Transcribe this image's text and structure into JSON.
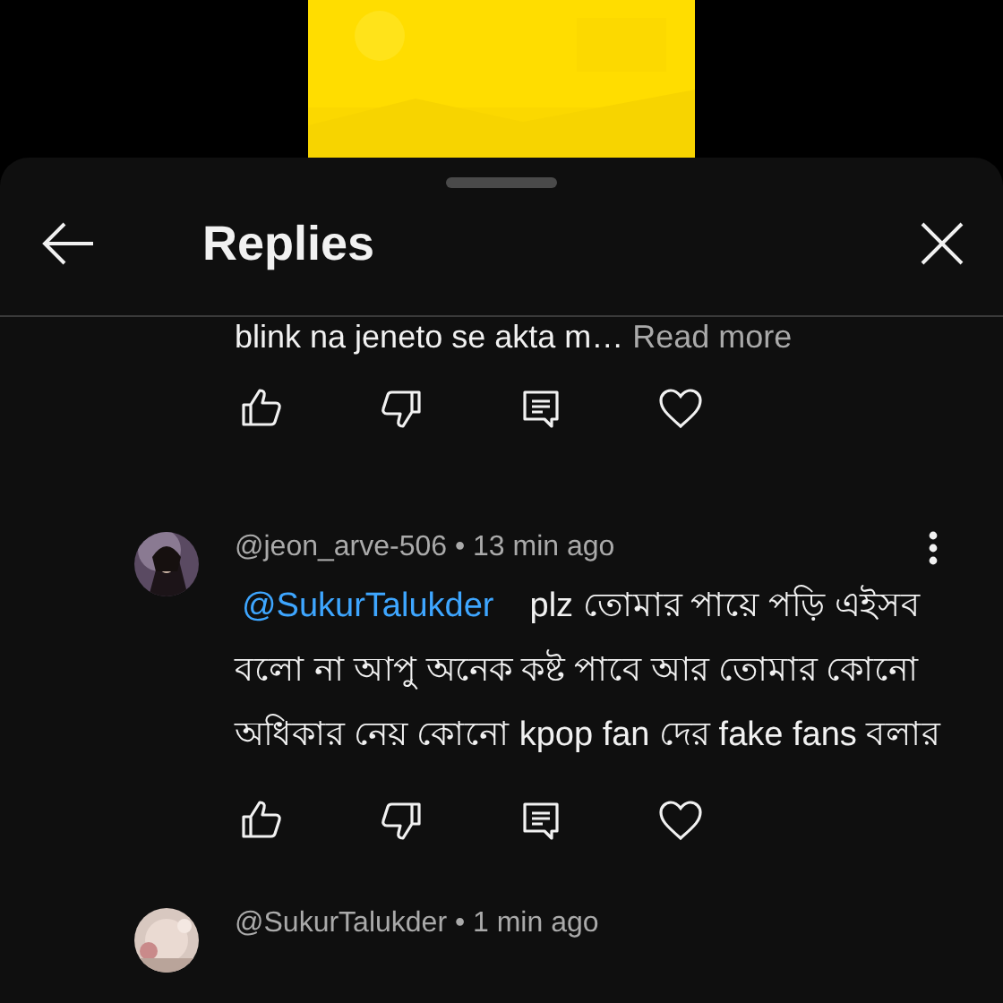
{
  "title": "Replies",
  "comments": [
    {
      "kind": "tail",
      "text": "blink na jeneto se akta m…",
      "read_more": "Read more"
    },
    {
      "kind": "full",
      "meta": "@jeon_arve-506 • 13 min ago",
      "mention": "@SukurTalukder",
      "text": "plz তোমার পায়ে পড়ি এইসব বলো না আপু অনেক কষ্ট পাবে আর তোমার কোনো অধিকার নেয় কোনো kpop fan দের fake fans বলার"
    },
    {
      "kind": "head",
      "meta": "@SukurTalukder • 1 min ago"
    }
  ]
}
